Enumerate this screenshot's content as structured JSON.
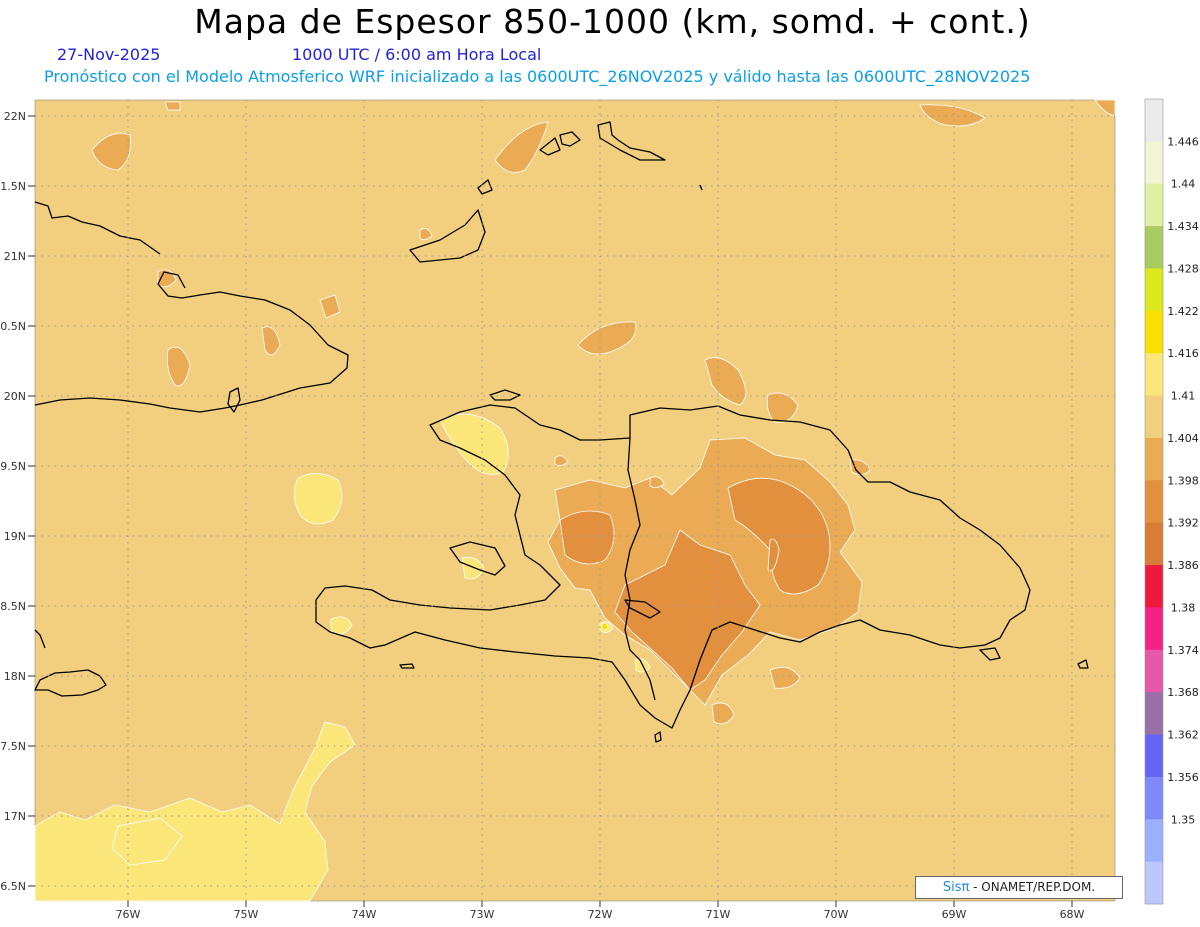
{
  "title": "Mapa de Espesor 850-1000 (km, somd. + cont.)",
  "date": "27-Nov-2025",
  "time": "1000 UTC / 6:00 am Hora Local",
  "description": "Pronóstico con el Modelo Atmosferico WRF inicializado a las 0600UTC_26NOV2025 y válido hasta las  0600UTC_28NOV2025",
  "credit": {
    "logo": "Sisπ",
    "text": "- ONAMET/REP.DOM."
  },
  "lat_labels": [
    "22N",
    "1.5N",
    "21N",
    "0.5N",
    "20N",
    "9.5N",
    "19N",
    "8.5N",
    "18N",
    "7.5N",
    "17N",
    "6.5N"
  ],
  "lon_labels": [
    "76W",
    "75W",
    "74W",
    "73W",
    "72W",
    "71W",
    "70W",
    "69W",
    "68W"
  ],
  "colorbar": {
    "labels": [
      "1.446",
      "1.44",
      "1.434",
      "1.428",
      "1.422",
      "1.416",
      "1.41",
      "1.404",
      "1.398",
      "1.392",
      "1.386",
      "1.38",
      "1.374",
      "1.368",
      "1.362",
      "1.356",
      "1.35"
    ],
    "colors": [
      "#ebebeb",
      "#f2f5d5",
      "#e0f0a2",
      "#a8cb62",
      "#dbe81c",
      "#f8e000",
      "#fbe67a",
      "#f2cf7e",
      "#ebab54",
      "#e28f3e",
      "#d87c36",
      "#ee1a3e",
      "#f42285",
      "#e759a8",
      "#9a6fa8",
      "#6464f5",
      "#7f89f9",
      "#9bb0fc",
      "#bcc7fc"
    ]
  },
  "legend_colors": {
    "background": "#f2cf7e",
    "medium": "#ebab54",
    "dark": "#e28f3e",
    "light": "#fbe67a",
    "yellow": "#f8e000"
  }
}
